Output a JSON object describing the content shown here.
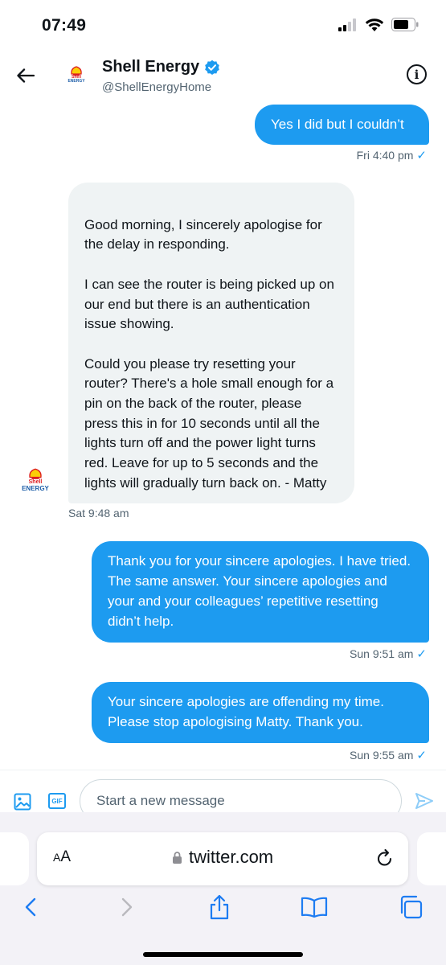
{
  "status_bar": {
    "time": "07:49"
  },
  "header": {
    "name": "Shell Energy",
    "handle": "@ShellEnergyHome",
    "avatar_logo_text": "Shell ENERGY"
  },
  "messages": [
    {
      "direction": "out",
      "text": "Yes I did but I couldn’t",
      "timestamp": "Fri 4:40 pm"
    },
    {
      "direction": "in",
      "text": "Good morning, I sincerely apologise for the delay in responding.\n\nI can see the router is being picked up on our end but there is an authentication issue showing.\n\nCould you please try resetting your router? There's a hole small enough for a pin on the back of the router, please press this in for 10 seconds until all the lights turn off and the power light turns red. Leave for up to 5 seconds and the lights will gradually turn back on. - Matty",
      "timestamp": "Sat 9:48 am"
    },
    {
      "direction": "out",
      "text": "Thank you for your sincere apologies. I have tried. The same answer. Your sincere apologies and your and your colleagues’ repetitive resetting didn’t help.",
      "timestamp": "Sun 9:51 am"
    },
    {
      "direction": "out",
      "text": "Your sincere apologies are offending my time. Please stop apologising Matty. Thank you.",
      "timestamp": "Sun 9:55 am"
    }
  ],
  "composer": {
    "placeholder": "Start a new message",
    "gif_label": "GIF"
  },
  "browser": {
    "aa_label_small": "A",
    "aa_label_large": "A",
    "url": "twitter.com"
  },
  "colors": {
    "accent": "#1d9bf0",
    "incoming_bubble": "#eff3f4",
    "shell_red": "#dd1d21",
    "shell_yellow": "#fbce07"
  },
  "icons": [
    "back-arrow-icon",
    "verified-badge-icon",
    "info-icon",
    "image-icon",
    "gif-icon",
    "send-icon",
    "lock-icon",
    "reload-icon",
    "back-chevron-icon",
    "forward-chevron-icon",
    "share-icon",
    "bookmarks-icon",
    "tabs-icon"
  ]
}
